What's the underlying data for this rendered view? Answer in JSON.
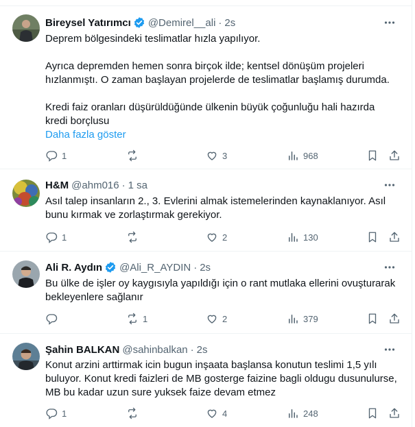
{
  "colors": {
    "accent": "#1d9bf0",
    "muted": "#536471",
    "text": "#0f1419",
    "border": "#eff3f4"
  },
  "tweets": [
    {
      "name": "Bireysel Yatırımcı",
      "verified": true,
      "handle": "@Demirel__ali",
      "dot": "·",
      "time": "2s",
      "text": "Deprem bölgesindeki teslimatlar hızla yapılıyor.\n\nAyrıca depremden hemen sonra birçok ilde; kentsel dönüşüm projeleri hızlanmıştı. O zaman başlayan projelerde de teslimatlar başlamış durumda.\n\nKredi faiz oranları düşürüldüğünde ülkenin büyük çoğunluğu hali hazırda kredi borçlusu",
      "show_more": "Daha fazla göster",
      "replies": "1",
      "retweets": "",
      "likes": "3",
      "views": "968",
      "avatar_icon": "avatar-photo"
    },
    {
      "name": "H&M",
      "verified": false,
      "handle": "@ahm016",
      "dot": "·",
      "time": "1 sa",
      "text": "Asıl talep insanların 2., 3. Evlerini almak istemelerinden kaynaklanıyor. Asıl bunu kırmak ve zorlaştırmak gerekiyor.",
      "show_more": "",
      "replies": "1",
      "retweets": "",
      "likes": "2",
      "views": "130",
      "avatar_icon": "avatar-photo"
    },
    {
      "name": "Ali R. Aydın",
      "verified": true,
      "handle": "@Ali_R_AYDIN",
      "dot": "·",
      "time": "2s",
      "text": "Bu ülke de işler oy kaygısıyla yapıldığı için  o rant mutlaka ellerini ovuşturarak bekleyenlere sağlanır",
      "show_more": "",
      "replies": "",
      "retweets": "1",
      "likes": "2",
      "views": "379",
      "avatar_icon": "avatar-photo"
    },
    {
      "name": "Şahin BALKAN",
      "verified": false,
      "handle": "@sahinbalkan",
      "dot": "·",
      "time": "2s",
      "text": "Konut arzini arttirmak icin bugun inşaata başlansa konutun teslimi 1,5 yılı buluyor. Konut kredi faizleri de MB gosterge faizine bagli oldugu dusunulurse, MB bu kadar uzun sure yuksek faize devam etmez",
      "show_more": "",
      "replies": "1",
      "retweets": "",
      "likes": "4",
      "views": "248",
      "avatar_icon": "avatar-photo"
    }
  ]
}
